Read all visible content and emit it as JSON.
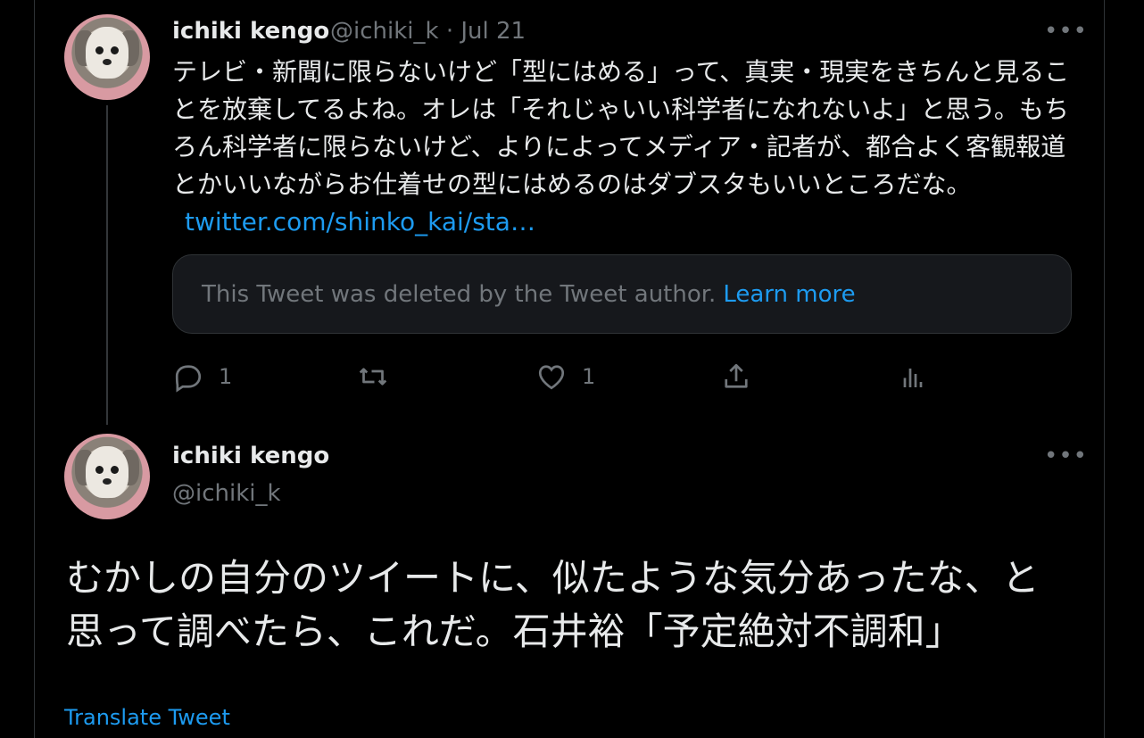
{
  "tweet1": {
    "author_name": "ichiki kengo",
    "handle": "@ichiki_k",
    "separator": "·",
    "date": "Jul 21",
    "text": "テレビ・新聞に限らないけど「型にはめる」って、真実・現実をきちんと見ることを放棄してるよね。オレは「それじゃいい科学者になれないよ」と思う。もちろん科学者に限らないけど、よりによってメディア・記者が、都合よく客観報道とかいいながらお仕着せの型にはめるのはダブスタもいいところだな。",
    "link": "twitter.com/shinko_kai/sta…",
    "deleted_notice": "This Tweet was deleted by the Tweet author.",
    "learn_more": "Learn more",
    "reply_count": "1",
    "like_count": "1",
    "more_icon": "more-horizontal-icon"
  },
  "tweet2": {
    "author_name": "ichiki kengo",
    "handle": "@ichiki_k",
    "text": "むかしの自分のツイートに、似たような気分あったな、と思って調べたら、これだ。石井裕「予定絶対不調和」",
    "translate": "Translate Tweet",
    "more_icon": "more-horizontal-icon"
  },
  "colors": {
    "background": "#000000",
    "text": "#e7e9ea",
    "muted": "#71767b",
    "link": "#1d9bf0",
    "card": "#16181c"
  }
}
